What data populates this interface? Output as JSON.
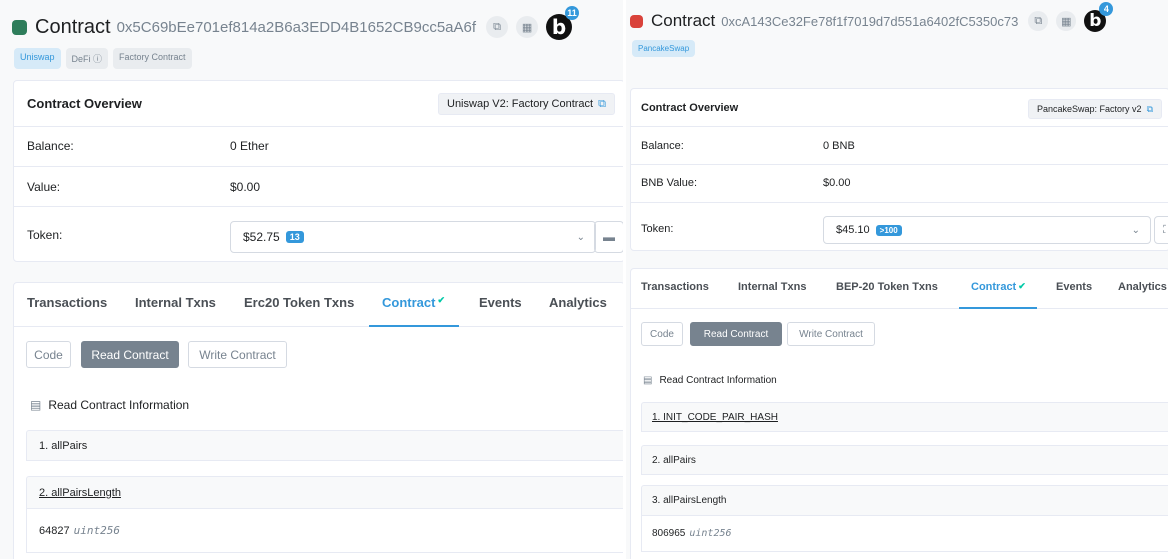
{
  "panels": [
    {
      "logo_color": "#2e7d5b",
      "header": {
        "title": "Contract",
        "address": "0x5C69bEe701ef814a2B6a3EDD4B1652CB9cc5aA6f",
        "copy_icon": "copy-icon",
        "qr_icon": "qr-icon",
        "bubble_letter": "b",
        "bubble_count": "11"
      },
      "tags": [
        "Uniswap",
        "DeFi ⓘ",
        "Factory Contract"
      ],
      "overview": {
        "title": "Contract Overview",
        "link": "Uniswap V2: Factory Contract",
        "rows": [
          {
            "label": "Balance:",
            "value": "0 Ether"
          },
          {
            "label": "Value:",
            "value": "$0.00"
          }
        ],
        "token": {
          "label": "Token:",
          "value": "$52.75",
          "badge": "13"
        }
      },
      "tabs": [
        "Transactions",
        "Internal Txns",
        "Erc20 Token Txns",
        "Contract",
        "Events",
        "Analytics"
      ],
      "active_tab": 3,
      "subtabs": [
        "Code",
        "Read Contract",
        "Write Contract"
      ],
      "read_title": "Read Contract Information",
      "functions": [
        "1. allPairs",
        "2. allPairsLength"
      ],
      "result": {
        "value": "64827",
        "type": "uint256"
      }
    },
    {
      "logo_color": "#d9423a",
      "header": {
        "title": "Contract",
        "address": "0xcA143Ce32Fe78f1f7019d7d551a6402fC5350c73",
        "copy_icon": "copy-icon",
        "qr_icon": "qr-icon",
        "bubble_letter": "b",
        "bubble_count": "4"
      },
      "tags": [
        "PancakeSwap"
      ],
      "overview": {
        "title": "Contract Overview",
        "link": "PancakeSwap: Factory v2",
        "rows": [
          {
            "label": "Balance:",
            "value": "0 BNB"
          },
          {
            "label": "BNB Value:",
            "value": "$0.00"
          }
        ],
        "token": {
          "label": "Token:",
          "value": "$45.10",
          "badge": ">100"
        }
      },
      "tabs": [
        "Transactions",
        "Internal Txns",
        "BEP-20 Token Txns",
        "Contract",
        "Events",
        "Analytics"
      ],
      "active_tab": 3,
      "subtabs": [
        "Code",
        "Read Contract",
        "Write Contract"
      ],
      "read_title": "Read Contract Information",
      "functions": [
        "1. INIT_CODE_PAIR_HASH",
        "2. allPairs",
        "3. allPairsLength"
      ],
      "result": {
        "value": "806965",
        "type": "uint256"
      }
    }
  ]
}
